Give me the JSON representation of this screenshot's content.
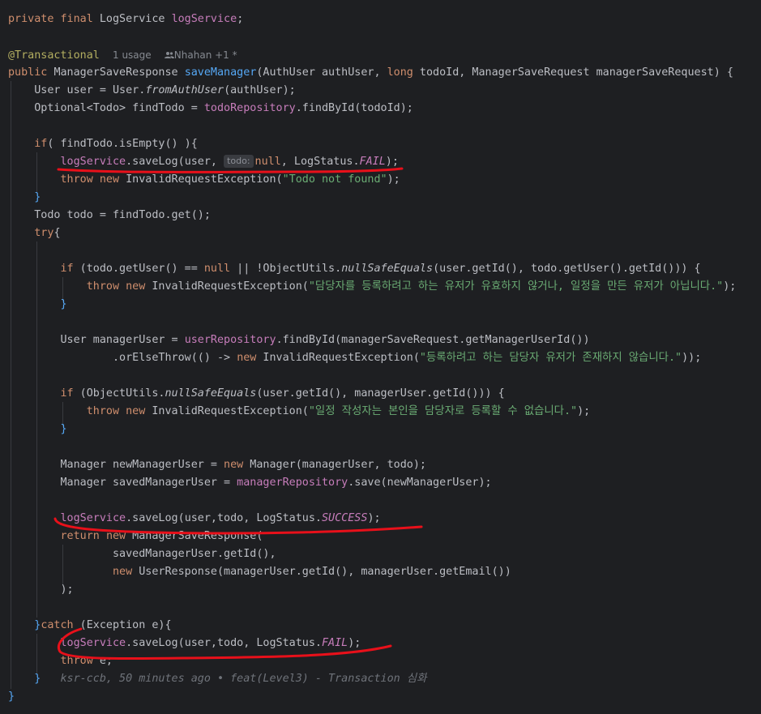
{
  "code": {
    "field_private": "private",
    "field_final": "final",
    "field_type": "LogService",
    "field_name": "logService",
    "annotation": "@Transactional",
    "usage_hint": "1 usage",
    "author_hint": "Nhahan +1 *",
    "sig_public": "public",
    "sig_return": "ManagerSaveResponse",
    "sig_method": "saveManager",
    "sig_params_1": "(AuthUser authUser, ",
    "sig_long": "long",
    "sig_params_2": " todoId, ManagerSaveRequest managerSaveRequest) {",
    "l4_a": "User user = User.",
    "l4_fn": "fromAuthUser",
    "l4_b": "(authUser);",
    "l5_a": "Optional<Todo> findTodo = ",
    "l5_repo": "todoRepository",
    "l5_b": ".findById(todoId);",
    "l7_if": "if",
    "l7_b": "( findTodo.isEmpty() ){",
    "log_svc": "logService",
    "savelog": ".saveLog(",
    "l8_a": "user, ",
    "inlay_todo": "todo:",
    "l8_null": "null",
    "l8_b": ", LogStatus.",
    "fail": "FAIL",
    "close_paren": ");",
    "throw_kw": "throw",
    "new_kw": "new",
    "invalid_ex": " InvalidRequestException(",
    "str_not_found": "\"Todo not found\"",
    "brace_close": "}",
    "l11": "Todo todo = findTodo.get();",
    "try_kw": "try",
    "brace_open": "{",
    "l14_if": "if",
    "l14_a": " (todo.getUser() == ",
    "l14_null": "null",
    "l14_b": " || !ObjectUtils.",
    "null_safe": "nullSafeEquals",
    "l14_c": "(user.getId(), todo.getUser().getId())) {",
    "str_manager_invalid": "\"담당자를 등록하려고 하는 유저가 유효하지 않거나, 일정을 만든 유저가 아닙니다.\"",
    "l17_a": "User managerUser = ",
    "l17_repo": "userRepository",
    "l17_b": ".findById(managerSaveRequest.getManagerUserId())",
    "l18_a": ".orElseThrow(() -> ",
    "str_user_not_exist": "\"등록하려고 하는 담당자 유저가 존재하지 않습니다.\"",
    "l18_end": "));",
    "l20_b": "(user.getId(), managerUser.getId())) {",
    "str_self": "\"일정 작성자는 본인을 담당자로 등록할 수 없습니다.\"",
    "l23_a": "Manager newManagerUser = ",
    "l23_b": " Manager(managerUser, todo);",
    "l24_a": "Manager savedManagerUser = ",
    "l24_repo": "managerRepository",
    "l24_b": ".save(newManagerUser);",
    "l26_a": "user,todo, LogStatus.",
    "success": "SUCCESS",
    "return_kw": "return",
    "l27_b": " ManagerSaveResponse(",
    "l28": "savedManagerUser.getId(),",
    "l29_b": " UserResponse(managerUser.getId(), managerUser.getEmail())",
    "l30": ");",
    "catch_kw": "catch",
    "l32_b": " (Exception e){",
    "l34_b": " e;",
    "blame": "ksr-ccb, 50 minutes ago • feat(Level3) - Transaction 심화"
  },
  "colors": {
    "background": "#1e1f22",
    "keyword": "#cf8e6d",
    "method": "#56a8f5",
    "field": "#c77dbb",
    "string": "#6aab73",
    "annotation": "#b3ae60",
    "text": "#bcbec4",
    "markup_red": "#e8101a"
  },
  "icons": {
    "author": "people-icon"
  }
}
